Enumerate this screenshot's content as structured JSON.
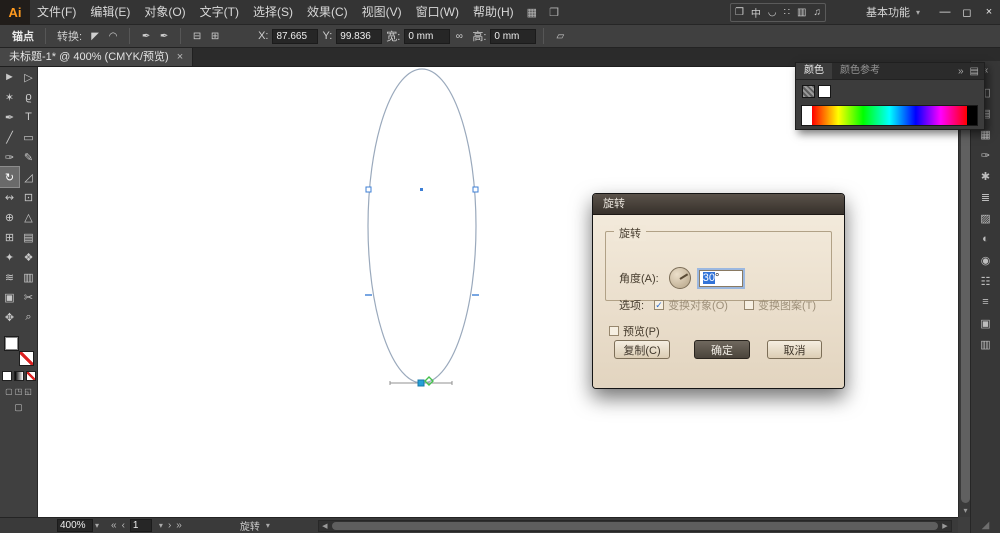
{
  "window": {
    "minimize": "—",
    "maximize": "◻",
    "close": "×"
  },
  "menubar": {
    "logo": "Ai",
    "items": [
      "文件(F)",
      "编辑(E)",
      "对象(O)",
      "文字(T)",
      "选择(S)",
      "效果(C)",
      "视图(V)",
      "窗口(W)",
      "帮助(H)"
    ],
    "bridge_icon": "▦",
    "arrange_documents_icon": "❐",
    "appbar_icons": [
      "❐",
      "中",
      "◡",
      "∷",
      "▥",
      "♫"
    ],
    "workspace_label": "基本功能",
    "caret": "▾"
  },
  "controlbar": {
    "anchor_label": "锚点",
    "convert_label": "转换:",
    "icons": {
      "convert_corner": "◤",
      "convert_smooth": "◠",
      "handles_show": "✒",
      "handles_hide": "✒",
      "anchor_remove": "⊟",
      "anchor_add": "⊞",
      "link": "∞",
      "transform_panel": "▱"
    },
    "x_label": "X:",
    "x_value": "87.665",
    "y_label": "Y:",
    "y_value": "99.836",
    "w_label": "宽:",
    "w_value": "0 mm",
    "h_label": "高:",
    "h_value": "0 mm"
  },
  "tabbar": {
    "doc_title": "未标题-1* @ 400% (CMYK/预览)",
    "close": "×"
  },
  "tools": [
    {
      "name": "selection",
      "glyph": "►"
    },
    {
      "name": "direct-selection",
      "glyph": "▷"
    },
    {
      "name": "magic-wand",
      "glyph": "✶"
    },
    {
      "name": "lasso",
      "glyph": "ϱ"
    },
    {
      "name": "pen",
      "glyph": "✒"
    },
    {
      "name": "type",
      "glyph": "T"
    },
    {
      "name": "line-segment",
      "glyph": "╱"
    },
    {
      "name": "rectangle",
      "glyph": "▭"
    },
    {
      "name": "paintbrush",
      "glyph": "✑"
    },
    {
      "name": "pencil",
      "glyph": "✎"
    },
    {
      "name": "rotate",
      "glyph": "↻"
    },
    {
      "name": "scale",
      "glyph": "◿"
    },
    {
      "name": "width",
      "glyph": "↭"
    },
    {
      "name": "free-transform",
      "glyph": "⊡"
    },
    {
      "name": "shape-builder",
      "glyph": "⊕"
    },
    {
      "name": "perspective-grid",
      "glyph": "△"
    },
    {
      "name": "mesh",
      "glyph": "⊞"
    },
    {
      "name": "gradient",
      "glyph": "▤"
    },
    {
      "name": "eyedropper",
      "glyph": "✦"
    },
    {
      "name": "blend",
      "glyph": "❖"
    },
    {
      "name": "symbol-sprayer",
      "glyph": "≋"
    },
    {
      "name": "column-graph",
      "glyph": "▥"
    },
    {
      "name": "artboard",
      "glyph": "▣"
    },
    {
      "name": "slice",
      "glyph": "✂"
    },
    {
      "name": "hand",
      "glyph": "✥"
    },
    {
      "name": "zoom",
      "glyph": "⌕"
    }
  ],
  "color_panel": {
    "tabs": [
      "颜色",
      "颜色参考"
    ],
    "expand_icon": "»",
    "menu_icon": "▤"
  },
  "dock": {
    "collapse_icon": "«",
    "icons": [
      "◧",
      "▤",
      "▦",
      "✑",
      "✱",
      "≣",
      "▨",
      "◐",
      "◉",
      "☷",
      "≡",
      "▣",
      "▥"
    ]
  },
  "dialog": {
    "title": "旋转",
    "group_label": "旋转",
    "angle_label": "角度(A):",
    "angle_value_selected": "30",
    "angle_suffix": "°",
    "options_label": "选项:",
    "check_glyph": "✓",
    "transform_object_label": "变换对象(O)",
    "transform_pattern_label": "变换图案(T)",
    "preview_label": "预览(P)",
    "copy_button": "复制(C)",
    "ok_button": "确定",
    "cancel_button": "取消"
  },
  "statusbar": {
    "zoom_value": "400%",
    "caret": "▾",
    "nav_first": "«",
    "nav_prev": "‹",
    "artboard_value": "1",
    "nav_next": "›",
    "nav_last": "»",
    "tool_label": "旋转",
    "scroll_left": "◀",
    "scroll_right": "▶",
    "vscroll_up": "▴",
    "vscroll_down": "▾"
  },
  "colors": {
    "accent_selection_blue": "#3d7fd6",
    "dialog_bg": "#e9decd",
    "ui_dark": "#3e3e3e",
    "logo_orange": "#ff9a1e"
  }
}
